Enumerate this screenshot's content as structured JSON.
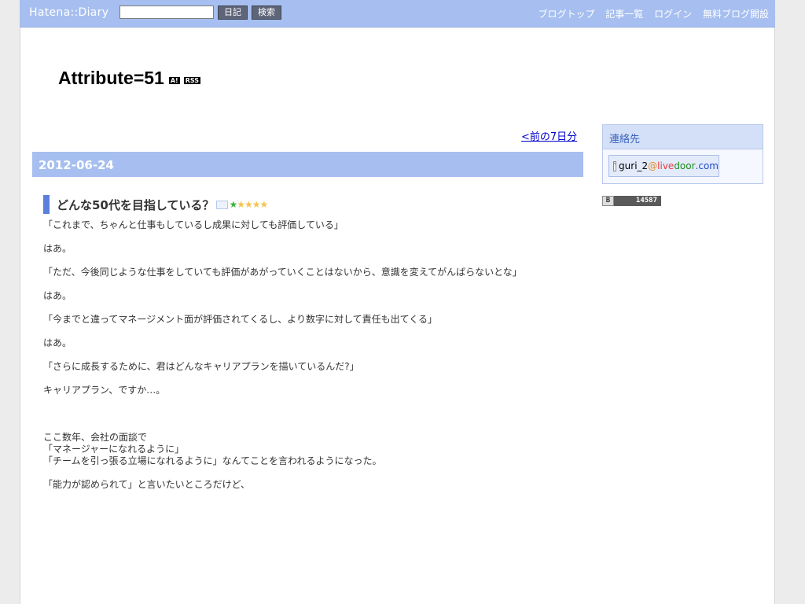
{
  "header": {
    "logo": "Hatena::Diary",
    "search_value": "",
    "diary_button": "日記",
    "search_button": "検索",
    "links": [
      "ブログトップ",
      "記事一覧",
      "ログイン",
      "無料ブログ開設"
    ]
  },
  "blog": {
    "title": "Attribute=51",
    "badge_ai": "A!",
    "badge_rss": "RSS"
  },
  "nav": {
    "prev_link": "<前の7日分"
  },
  "day": {
    "date": "2012-06-24"
  },
  "entry": {
    "title": "どんな50代を目指している？",
    "star_add": "★",
    "stars": "★★★★",
    "lines": [
      "「これまで、ちゃんと仕事もしているし成果に対しても評価している」",
      "",
      "はあ。",
      "",
      "「ただ、今後同じような仕事をしていても評価があがっていくことはないから、意識を変えてがんばらないとな」",
      "",
      "はあ。",
      "",
      "「今までと違ってマネージメント面が評価されてくるし、より数字に対して責任も出てくる」",
      "",
      "はあ。",
      "",
      "「さらに成長するために、君はどんなキャリアプランを描いているんだ?」",
      "",
      "キャリアプラン、ですか…。",
      "",
      "",
      "",
      "ここ数年、会社の面談で",
      "「マネージャーになれるように」",
      "「チームを引っ張る立場になれるように」なんてことを言われるようになった。",
      "",
      "「能力が認められて」と言いたいところだけど、"
    ]
  },
  "sidebar": {
    "contact_title": "連絡先",
    "mail_user": "guri_2",
    "mail_at": "@",
    "mail_live": "live",
    "mail_door": "door",
    "mail_com": ".com",
    "counter_label": "B",
    "counter_value": "14587"
  },
  "colors": {
    "header_bg": "#a6bff0",
    "section_bar": "#5b7fdd",
    "link": "#0000cc"
  }
}
